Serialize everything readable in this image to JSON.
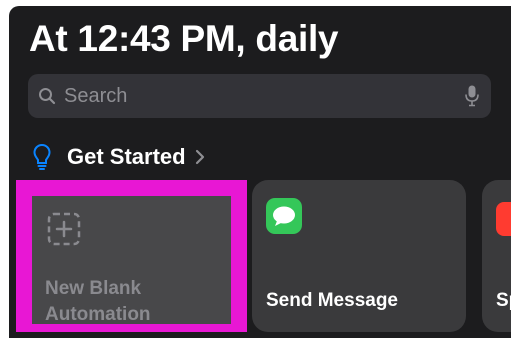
{
  "header": {
    "title": "At 12:43 PM, daily"
  },
  "search": {
    "placeholder": "Search"
  },
  "section": {
    "label": "Get Started"
  },
  "cards": [
    {
      "label": "New Blank Automation",
      "icon": "add-square-dashed-icon"
    },
    {
      "label": "Send Message",
      "icon": "message-bubble-icon"
    },
    {
      "label": "Sp",
      "icon": "red-app-icon"
    }
  ],
  "colors": {
    "background": "#1c1c1e",
    "card": "#3a3a3c",
    "highlight": "#e817d4",
    "messages_green": "#34c759",
    "bulb_blue": "#0a84ff"
  }
}
